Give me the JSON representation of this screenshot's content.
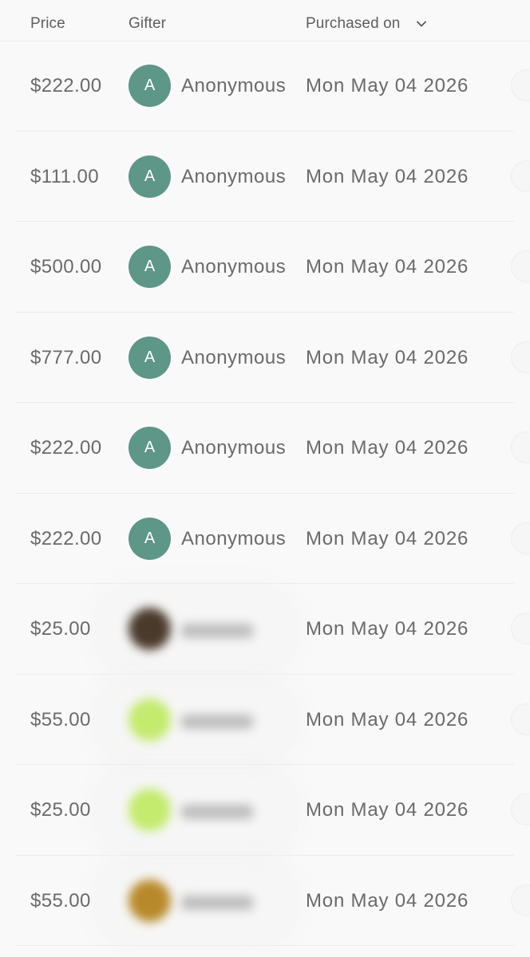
{
  "header": {
    "price_label": "Price",
    "gifter_label": "Gifter",
    "purchased_label": "Purchased on",
    "sort_icon": "chevron-down-icon"
  },
  "rows": [
    {
      "price": "$222.00",
      "avatar_letter": "A",
      "gifter": "Anonymous",
      "date": "Mon May 04 2026"
    },
    {
      "price": "$111.00",
      "avatar_letter": "A",
      "gifter": "Anonymous",
      "date": "Mon May 04 2026"
    },
    {
      "price": "$500.00",
      "avatar_letter": "A",
      "gifter": "Anonymous",
      "date": "Mon May 04 2026"
    },
    {
      "price": "$777.00",
      "avatar_letter": "A",
      "gifter": "Anonymous",
      "date": "Mon May 04 2026"
    },
    {
      "price": "$222.00",
      "avatar_letter": "A",
      "gifter": "Anonymous",
      "date": "Mon May 04 2026"
    },
    {
      "price": "$222.00",
      "avatar_letter": "A",
      "gifter": "Anonymous",
      "date": "Mon May 04 2026"
    },
    {
      "price": "$25.00",
      "avatar_letter": "",
      "avatar_color": "#4a3a2c",
      "gifter": "",
      "date": "Mon May 04 2026",
      "blurred": true
    },
    {
      "price": "$55.00",
      "avatar_letter": "",
      "avatar_color": "#c4ea6e",
      "gifter": "",
      "date": "Mon May 04 2026",
      "blurred": true
    },
    {
      "price": "$25.00",
      "avatar_letter": "",
      "avatar_color": "#c4ea6e",
      "gifter": "",
      "date": "Mon May 04 2026",
      "blurred": true
    },
    {
      "price": "$55.00",
      "avatar_letter": "",
      "avatar_color": "#b8892a",
      "gifter": "",
      "date": "Mon May 04 2026",
      "blurred": true
    }
  ],
  "colors": {
    "anonymous_avatar": "#5e9688",
    "background": "#f9f9f9",
    "text": "#6a6a6a"
  }
}
